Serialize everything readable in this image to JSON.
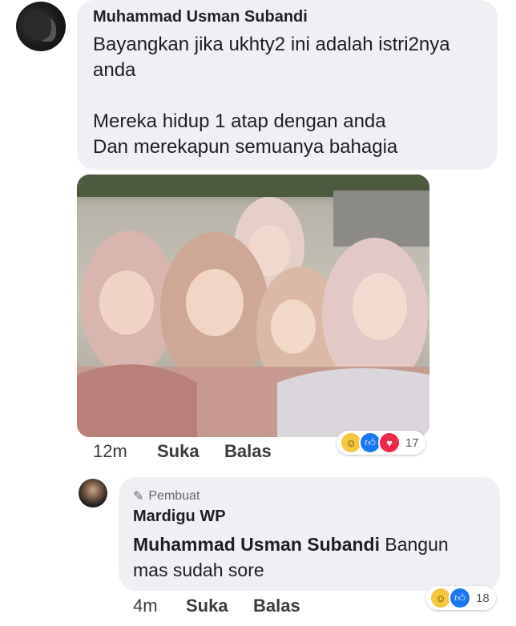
{
  "comment1": {
    "author": "Muhammad Usman Subandi",
    "text": "Bayangkan jika ukhty2 ini adalah istri2nya\nanda\n\nMereka hidup 1 atap dengan anda\nDan merekapun semuanya bahagia",
    "time": "12m",
    "like_label": "Suka",
    "reply_label": "Balas",
    "reactions": [
      "haha-icon",
      "like-icon",
      "love-icon"
    ],
    "reaction_count": "17"
  },
  "comment2": {
    "badge": "Pembuat",
    "author": "Mardigu WP",
    "mention": "Muhammad Usman Subandi",
    "text": " Bangun mas sudah sore",
    "time": "4m",
    "like_label": "Suka",
    "reply_label": "Balas",
    "reactions": [
      "haha-icon",
      "like-icon"
    ],
    "reaction_count": "18"
  },
  "colors": {
    "bubble": "#eef0f3",
    "like": "#1877f2",
    "love": "#f0284a",
    "haha": "#f7c63e"
  }
}
